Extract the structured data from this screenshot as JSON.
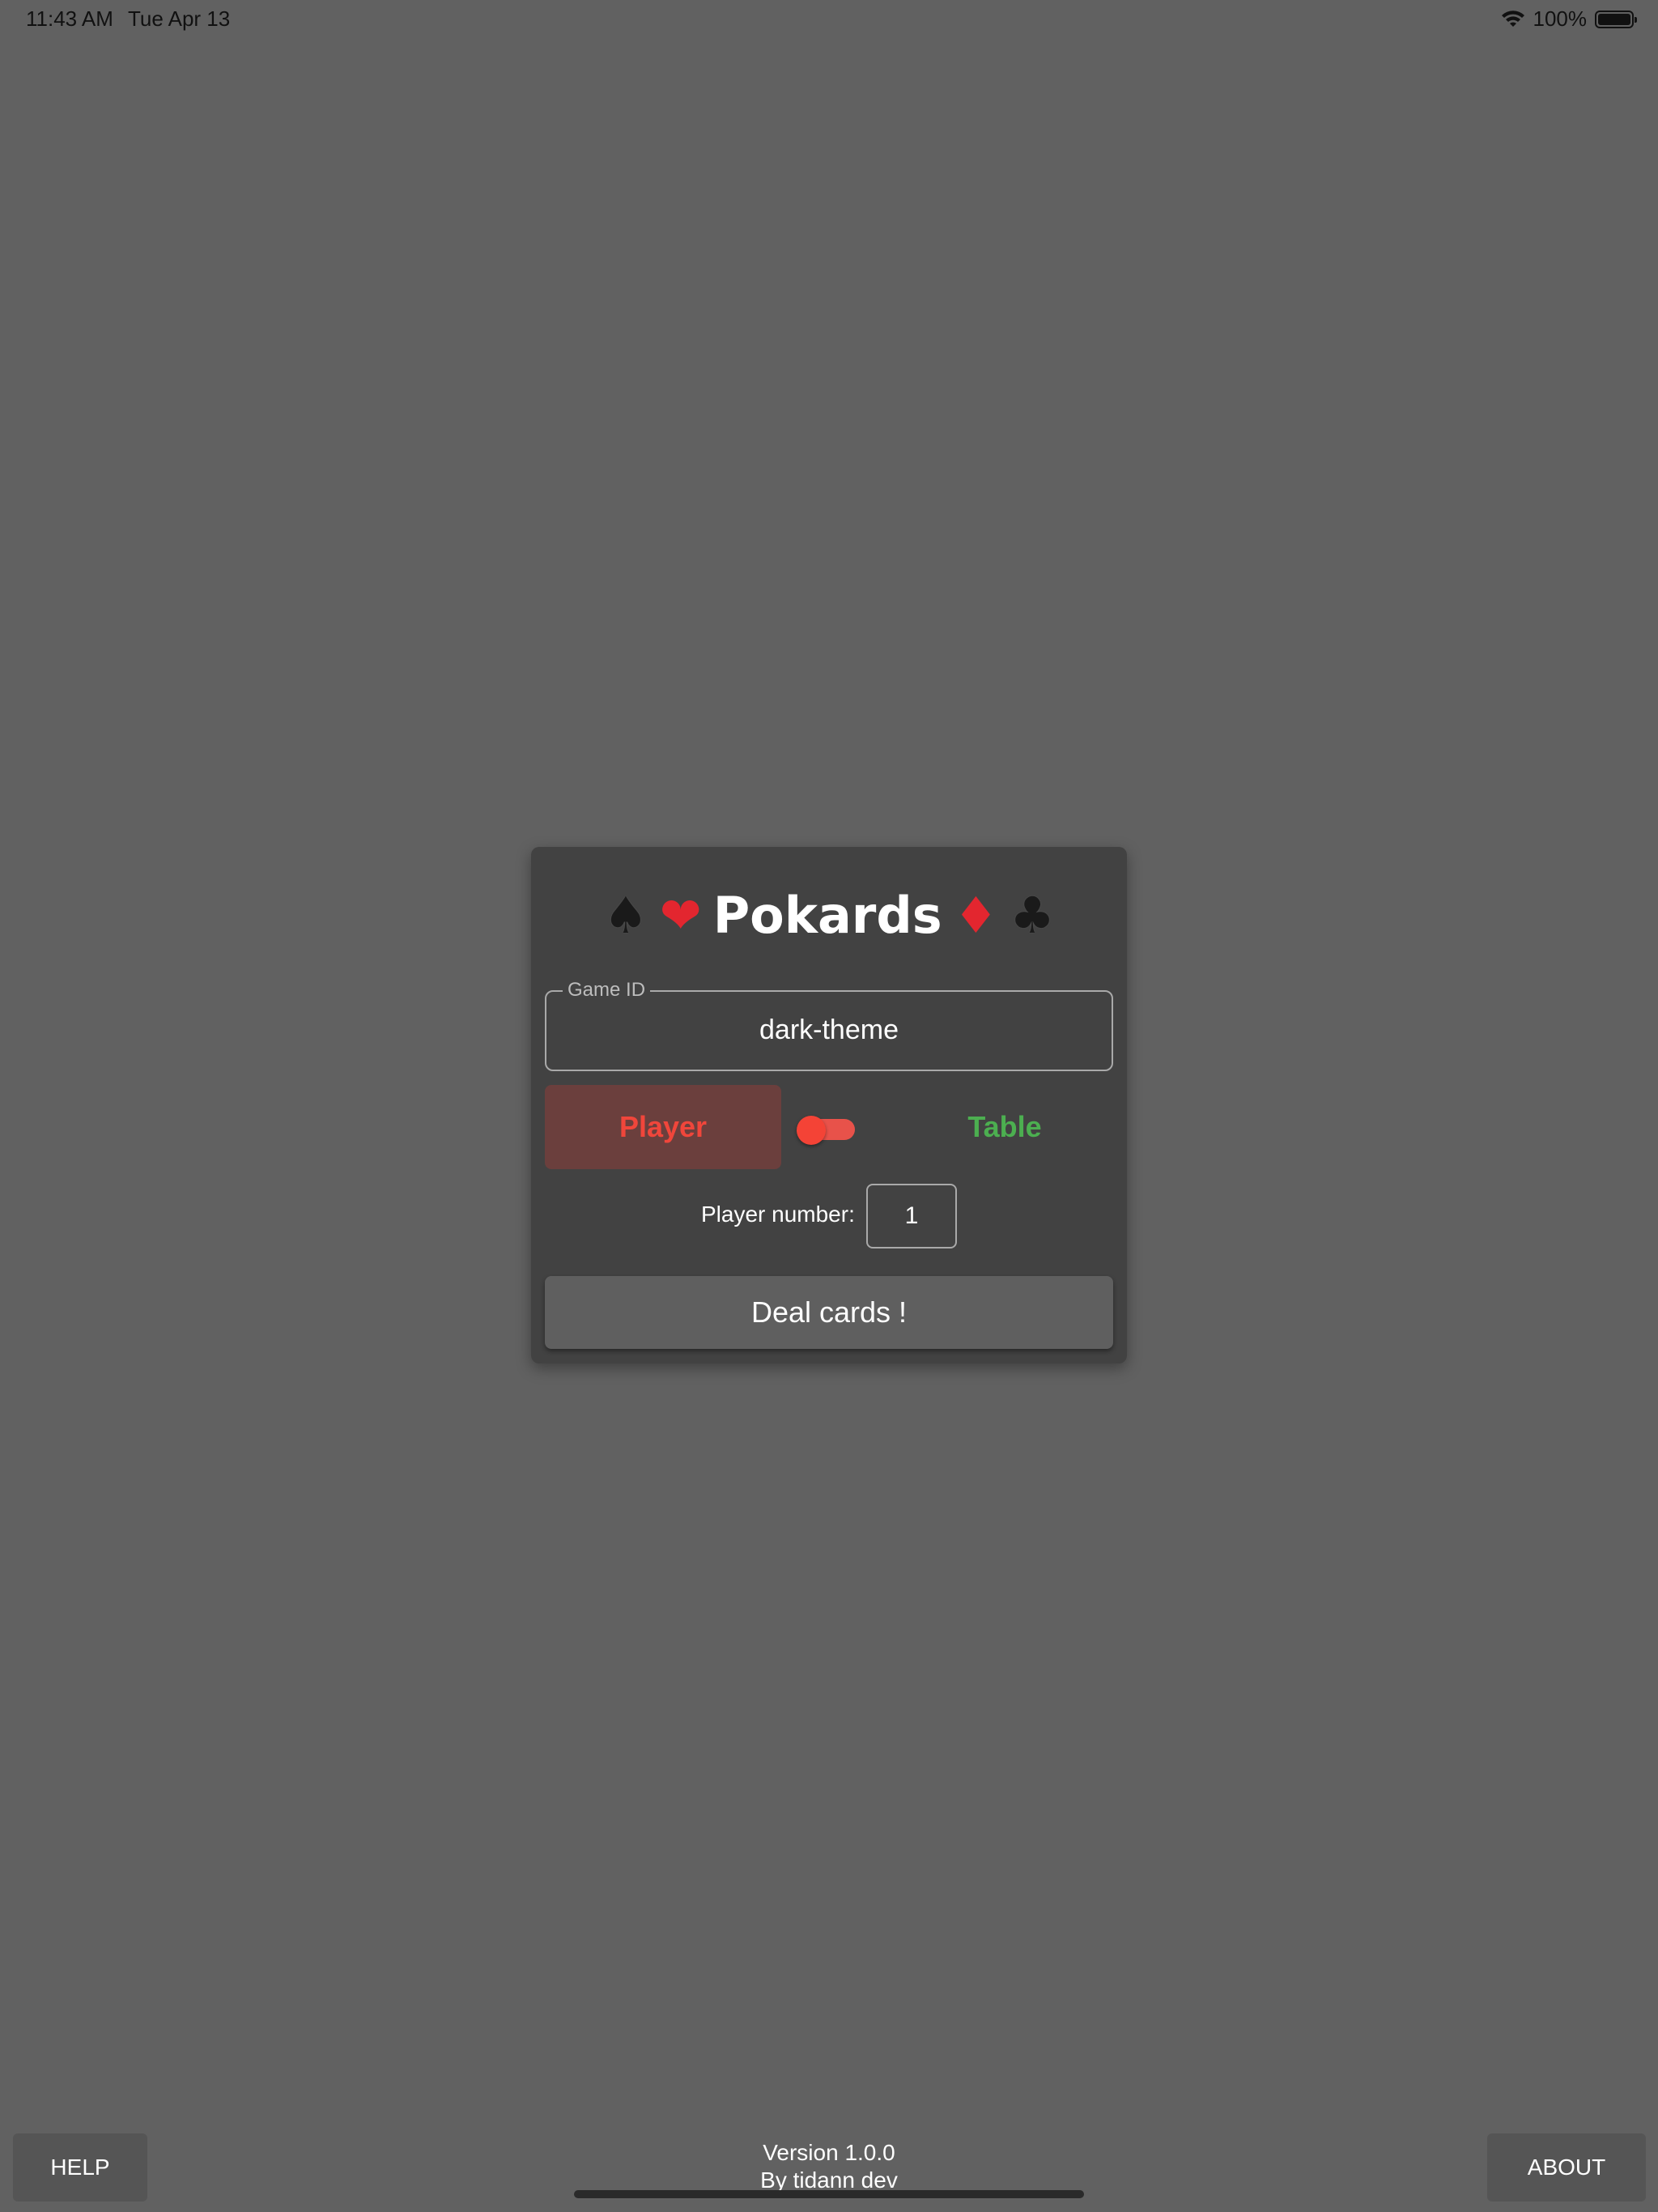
{
  "status_bar": {
    "time": "11:43 AM",
    "date": "Tue Apr 13",
    "battery": "100%",
    "wifi_icon": "wifi-icon",
    "battery_icon": "battery-full-icon"
  },
  "card": {
    "title": "Pokards",
    "suits": {
      "spade": "♠",
      "heart": "❤",
      "diamond": "♦",
      "club": "♣"
    },
    "game_id": {
      "label": "Game ID",
      "value": "dark-theme"
    },
    "role": {
      "player_label": "Player",
      "table_label": "Table",
      "selected": "Player"
    },
    "player_number": {
      "label": "Player number:",
      "value": "1"
    },
    "deal_button": "Deal cards !"
  },
  "footer": {
    "help": "HELP",
    "about": "ABOUT",
    "version": "Version 1.0.0",
    "author": "By tidann dev"
  },
  "colors": {
    "background": "#616161",
    "card": "#424242",
    "player_accent": "#f0463b",
    "table_accent": "#4caf50"
  }
}
